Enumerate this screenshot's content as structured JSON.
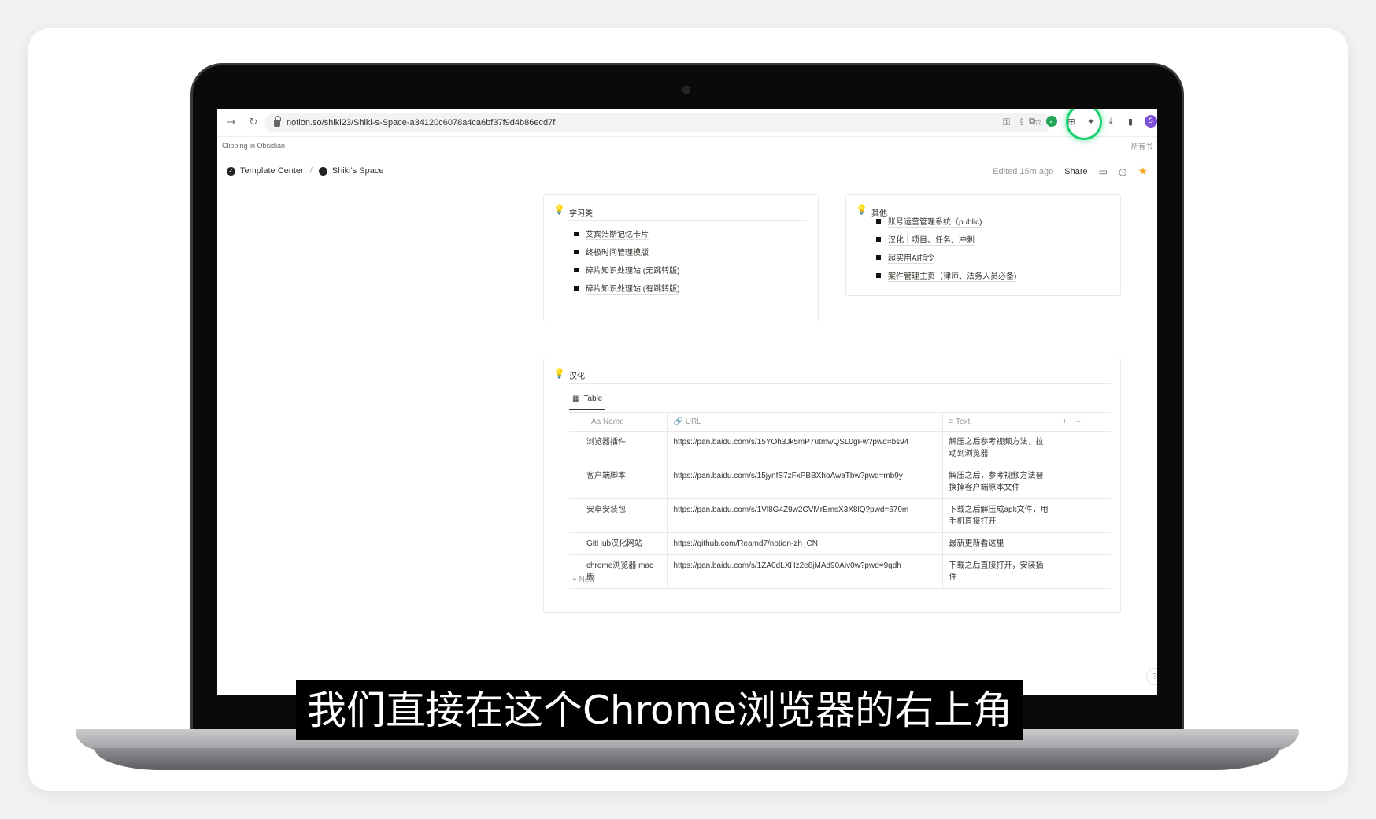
{
  "browser": {
    "url": "notion.so/shiki23/Shiki-s-Space-a34120c6078a4ca6bf37f9d4b86ecd7f",
    "bookmark_label": "Clipping in Obsidian",
    "bookmark_right": "所有书",
    "profile_initial": "S"
  },
  "notion": {
    "breadcrumb": [
      "Template Center",
      "Shiki's Space"
    ],
    "edited": "Edited 15m ago",
    "share": "Share"
  },
  "callout_study": {
    "title": "学习类",
    "items": [
      "艾宾浩斯记忆卡片",
      "终极时间管理模版",
      "碎片知识处理站 (无跳转版)",
      "碎片知识处理站 (有跳转版)"
    ]
  },
  "callout_other": {
    "title": "其他",
    "items": [
      "账号运营管理系统（public)",
      "汉化｜项目、任务、冲刺",
      "超实用AI指令",
      "案件管理主页（律师、法务人员必备)"
    ]
  },
  "callout_hanhua": {
    "title": "汉化",
    "tab": "Table",
    "columns": [
      "Aa Name",
      "URL",
      "Text"
    ],
    "rows": [
      {
        "name": "浏览器插件",
        "url": "https://pan.baidu.com/s/15YOh3Jk5mP7utmwQSL0gFw?pwd=bs94",
        "text": "解压之后参考视频方法，拉动到浏览器"
      },
      {
        "name": "客户端脚本",
        "url": "https://pan.baidu.com/s/15jynfS7zFxPBBXhoAwaTbw?pwd=mb9y",
        "text": "解压之后，参考视频方法替换掉客户端原本文件"
      },
      {
        "name": "安卓安装包",
        "url": "https://pan.baidu.com/s/1Vl8G4Z9w2CVMrEmsX3X8lQ?pwd=679m",
        "text": "下载之后解压成apk文件，用手机直接打开"
      },
      {
        "name": "GitHub汉化网站",
        "url": "https://github.com/Reamd7/notion-zh_CN",
        "text": "最新更新看这里"
      },
      {
        "name": "chrome浏览器 mac版",
        "url": "https://pan.baidu.com/s/1ZA0dLXHz2e8jMAd90Aiv0w?pwd=9gdh",
        "text": "下载之后直接打开，安装插件"
      }
    ],
    "new_label": "+ New"
  },
  "subtitle": "我们直接在这个Chrome浏览器的右上角",
  "colors": {
    "highlight": "#18d46f",
    "star": "#f5a623"
  }
}
